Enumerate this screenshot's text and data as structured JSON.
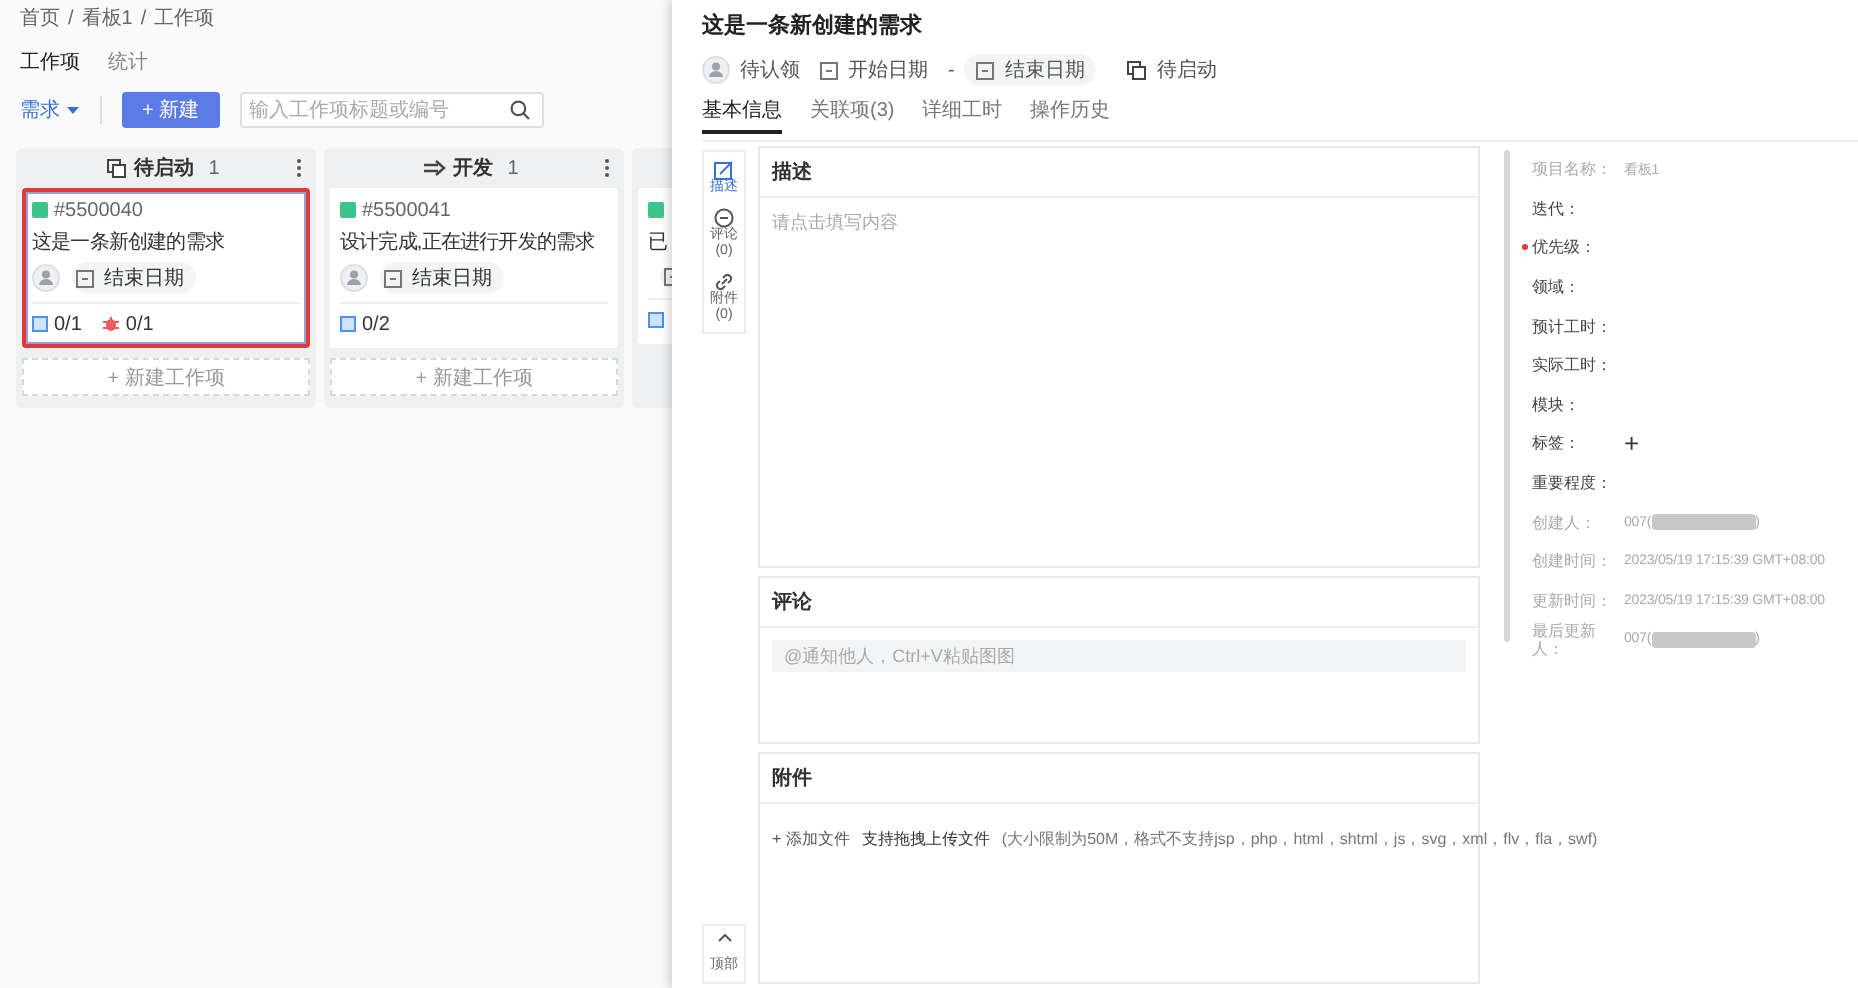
{
  "breadcrumb": [
    {
      "label": "首页",
      "sep": "/"
    },
    {
      "label": "看板1",
      "sep": "/"
    },
    {
      "label": "工作项"
    }
  ],
  "page_tabs": [
    {
      "label": "工作项",
      "selected": true
    },
    {
      "label": "统计",
      "selected": false
    }
  ],
  "toolbar": {
    "type_filter": "需求",
    "new_button": "+ 新建",
    "search": {
      "placeholder": "输入工作项标题或编号"
    }
  },
  "columns": [
    {
      "title": "待启动",
      "count": "1",
      "add_label": "+ 新建工作项",
      "cards": [
        {
          "id": "#5500040",
          "title": "这是一条新创建的需求",
          "due": "结束日期",
          "highlighted": true,
          "counts": [
            {
              "kind": "task",
              "text": "0/1"
            },
            {
              "kind": "bug",
              "text": "0/1"
            }
          ]
        }
      ]
    },
    {
      "title": "开发",
      "count": "1",
      "add_label": "+ 新建工作项",
      "cards": [
        {
          "id": "#5500041",
          "title": "设计完成,正在进行开发的需求",
          "due": "结束日期",
          "highlighted": false,
          "counts": [
            {
              "kind": "task",
              "text": "0/2"
            }
          ]
        }
      ]
    },
    {
      "cards": [
        {
          "title": "已",
          "counts": [
            {
              "kind": "task"
            }
          ]
        }
      ]
    }
  ],
  "detail": {
    "title": "这是一条新创建的需求",
    "assignee": "待认领",
    "start_date": "开始日期",
    "date_sep": "-",
    "end_date": "结束日期",
    "status": "待启动",
    "tabs": [
      {
        "label": "基本信息",
        "selected": true
      },
      {
        "label": "关联项(3)",
        "selected": false
      },
      {
        "label": "详细工时",
        "selected": false
      },
      {
        "label": "操作历史",
        "selected": false
      }
    ],
    "side_nav": [
      {
        "label": "描述",
        "selected": true
      },
      {
        "label": "评论(0)",
        "selected": false
      },
      {
        "label": "附件(0)",
        "selected": false
      }
    ],
    "back_to_top": "顶部",
    "sections": [
      {
        "kind": "description",
        "title": "描述",
        "placeholder": "请点击填写内容"
      },
      {
        "kind": "comment",
        "title": "评论",
        "placeholder": "@通知他人，Ctrl+V粘贴图图"
      },
      {
        "kind": "attachment",
        "title": "附件",
        "add_label": "+ 添加文件",
        "hint": "支持拖拽上传文件",
        "note": "(大小限制为50M，格式不支持jsp，php，html，shtml，js，svg，xml，flv，fla，swf)"
      }
    ],
    "fields": [
      {
        "label": "项目名称：",
        "value": "看板1",
        "readonly": true
      },
      {
        "label": "迭代：",
        "readonly": false
      },
      {
        "label": "优先级：",
        "required": true,
        "readonly": false
      },
      {
        "label": "领域：",
        "readonly": false
      },
      {
        "label": "预计工时：",
        "readonly": false
      },
      {
        "label": "实际工时：",
        "readonly": false
      },
      {
        "label": "模块：",
        "readonly": false
      },
      {
        "label": "标签：",
        "add": "+",
        "readonly": false
      },
      {
        "label": "重要程度：",
        "readonly": false
      },
      {
        "label": "创建人：",
        "value": "007(",
        "suffix": ")",
        "redacted": true,
        "readonly": true
      },
      {
        "label": "创建时间：",
        "value": "2023/05/19 17:15:39 GMT+08:00",
        "readonly": true
      },
      {
        "label": "更新时间：",
        "value": "2023/05/19 17:15:39 GMT+08:00",
        "readonly": true
      },
      {
        "label": "最后更新人：",
        "value": "007(",
        "suffix": ")",
        "redacted": true,
        "readonly": true
      }
    ]
  }
}
